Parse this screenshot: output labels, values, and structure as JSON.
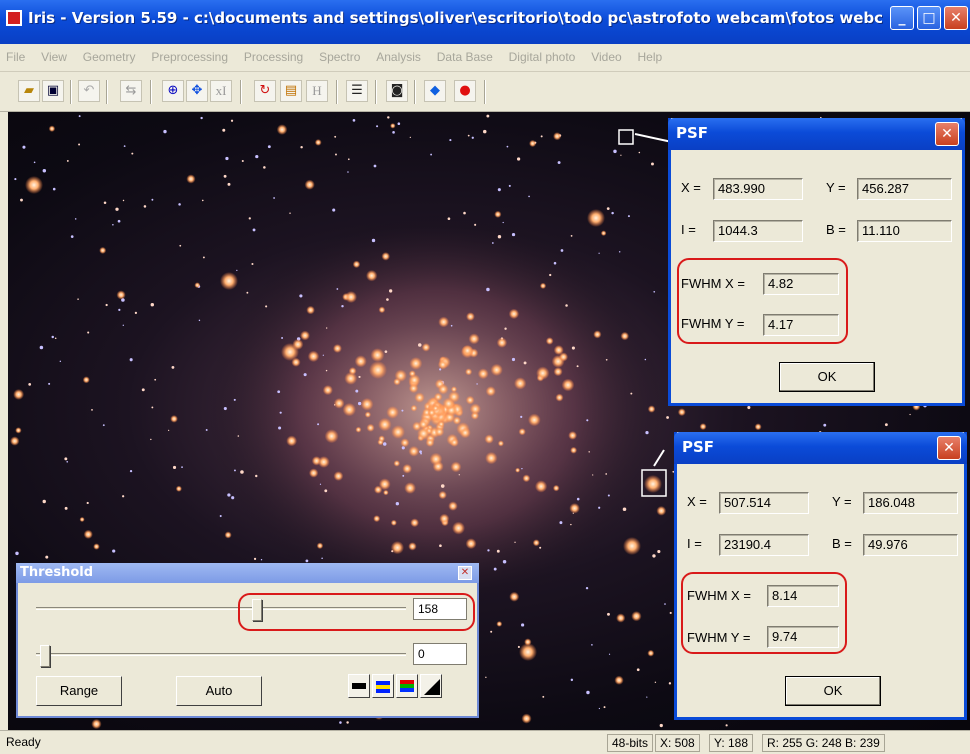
{
  "window": {
    "title": "Iris - Version 5.59 - c:\\documents and settings\\oliver\\escritorio\\todo pc\\astrofoto webcam\\fotos webcam\\..."
  },
  "menu": [
    "File",
    "View",
    "Geometry",
    "Preprocessing",
    "Processing",
    "Spectro",
    "Analysis",
    "Data Base",
    "Digital photo",
    "Video",
    "Help"
  ],
  "toolbar": {
    "icons": [
      "open-folder",
      "save",
      "undo",
      "flip",
      "crosshair",
      "move",
      "xI",
      "rotate",
      "histogram",
      "H",
      "list",
      "camera",
      "diamond",
      "red-dot"
    ],
    "xi_label": "xI",
    "h_label": "H"
  },
  "psf1": {
    "title": "PSF",
    "x_label": "X =",
    "x": "483.990",
    "y_label": "Y =",
    "y": "456.287",
    "i_label": "I =",
    "i": "1044.3",
    "b_label": "B =",
    "b": "11.110",
    "fwhmx_label": "FWHM X =",
    "fwhmx": "4.82",
    "fwhmy_label": "FWHM Y =",
    "fwhmy": "4.17",
    "ok": "OK"
  },
  "psf2": {
    "title": "PSF",
    "x_label": "X =",
    "x": "507.514",
    "y_label": "Y =",
    "y": "186.048",
    "i_label": "I =",
    "i": "23190.4",
    "b_label": "B =",
    "b": "49.976",
    "fwhmx_label": "FWHM X =",
    "fwhmx": "8.14",
    "fwhmy_label": "FWHM Y =",
    "fwhmy": "9.74",
    "ok": "OK"
  },
  "threshold": {
    "title": "Threshold",
    "high_value": "158",
    "low_value": "0",
    "range_label": "Range",
    "auto_label": "Auto"
  },
  "status": {
    "text": "Ready",
    "bits": "48-bits",
    "x": "X: 508",
    "y": "Y: 188",
    "rgb": "R: 255  G: 248  B: 239"
  },
  "colors": {
    "titlebar": "#0b4bd8",
    "highlight": "#d91a1a",
    "dialog_bg": "#ece9d8"
  }
}
